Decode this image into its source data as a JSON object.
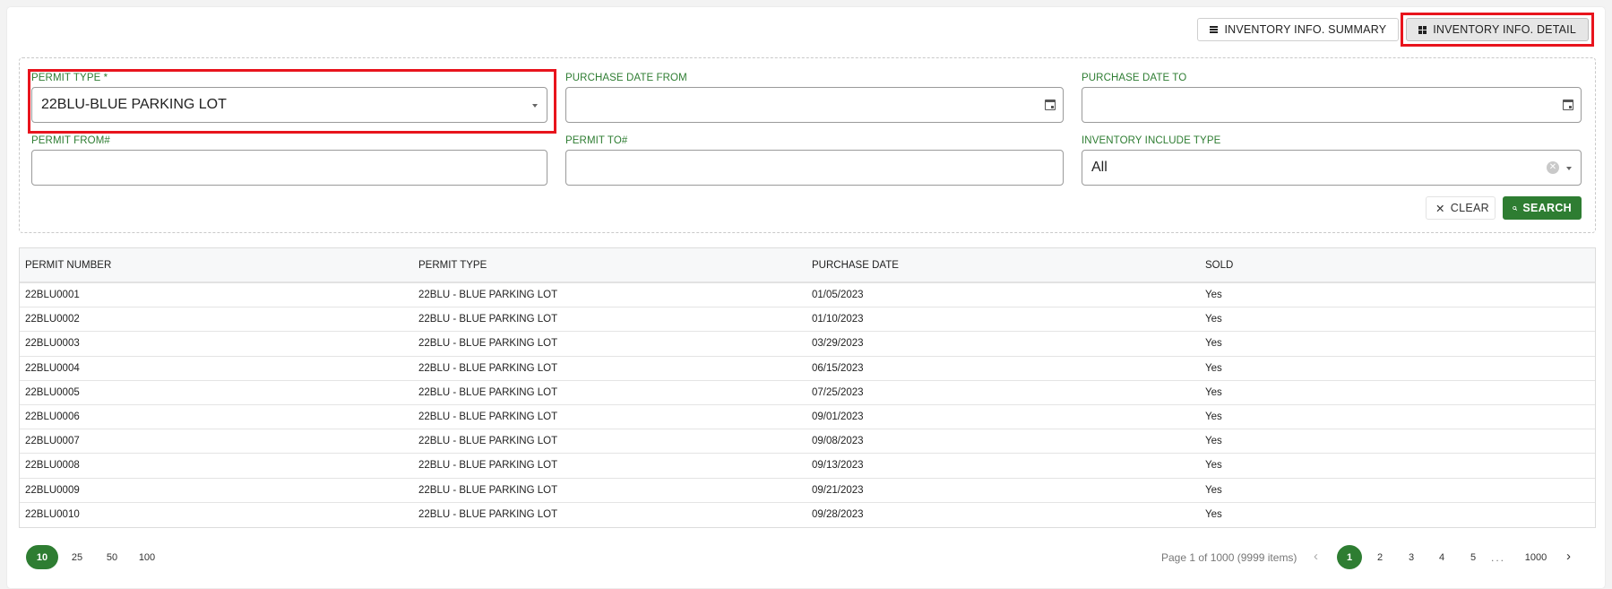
{
  "view_toggle": {
    "summary_label": "INVENTORY INFO. SUMMARY",
    "detail_label": "INVENTORY INFO. DETAIL"
  },
  "filters": {
    "permit_type": {
      "label": "PERMIT TYPE *",
      "value": "22BLU-BLUE PARKING LOT"
    },
    "purchase_date_from": {
      "label": "PURCHASE DATE FROM",
      "value": ""
    },
    "purchase_date_to": {
      "label": "PURCHASE DATE TO",
      "value": ""
    },
    "permit_from": {
      "label": "PERMIT FROM#",
      "value": ""
    },
    "permit_to": {
      "label": "PERMIT TO#",
      "value": ""
    },
    "inventory_include_type": {
      "label": "INVENTORY INCLUDE TYPE",
      "value": "All"
    },
    "clear_label": "CLEAR",
    "search_label": "SEARCH"
  },
  "grid": {
    "columns": [
      "PERMIT NUMBER",
      "PERMIT TYPE",
      "PURCHASE DATE",
      "SOLD"
    ],
    "rows": [
      [
        "22BLU0001",
        "22BLU - BLUE PARKING LOT",
        "01/05/2023",
        "Yes"
      ],
      [
        "22BLU0002",
        "22BLU - BLUE PARKING LOT",
        "01/10/2023",
        "Yes"
      ],
      [
        "22BLU0003",
        "22BLU - BLUE PARKING LOT",
        "03/29/2023",
        "Yes"
      ],
      [
        "22BLU0004",
        "22BLU - BLUE PARKING LOT",
        "06/15/2023",
        "Yes"
      ],
      [
        "22BLU0005",
        "22BLU - BLUE PARKING LOT",
        "07/25/2023",
        "Yes"
      ],
      [
        "22BLU0006",
        "22BLU - BLUE PARKING LOT",
        "09/01/2023",
        "Yes"
      ],
      [
        "22BLU0007",
        "22BLU - BLUE PARKING LOT",
        "09/08/2023",
        "Yes"
      ],
      [
        "22BLU0008",
        "22BLU - BLUE PARKING LOT",
        "09/13/2023",
        "Yes"
      ],
      [
        "22BLU0009",
        "22BLU - BLUE PARKING LOT",
        "09/21/2023",
        "Yes"
      ],
      [
        "22BLU0010",
        "22BLU - BLUE PARKING LOT",
        "09/28/2023",
        "Yes"
      ]
    ]
  },
  "pager": {
    "page_sizes": [
      "10",
      "25",
      "50",
      "100"
    ],
    "info": "Page 1 of 1000 (9999 items)",
    "pages": [
      "1",
      "2",
      "3",
      "4",
      "5"
    ],
    "ellipsis": "...",
    "last_page": "1000"
  },
  "colors": {
    "accent": "#2e7d32",
    "highlight": "#e8141d"
  },
  "icons": {
    "summary": "list-icon",
    "detail": "grid-icon",
    "date": "calendar-icon",
    "clear": "close-icon",
    "search": "search-icon"
  }
}
